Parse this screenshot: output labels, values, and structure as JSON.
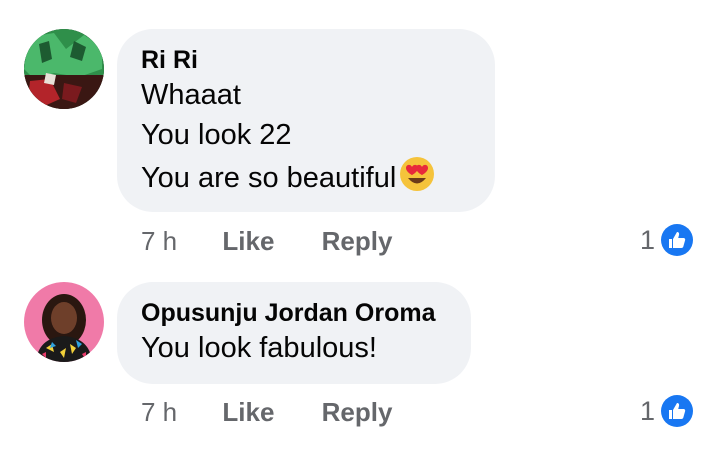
{
  "comments": [
    {
      "author": "Ri Ri",
      "lines": [
        "Whaaat",
        "You look 22",
        "You are so beautiful"
      ],
      "emoji": "heart-eyes-emoji",
      "time": "7 h",
      "like_label": "Like",
      "reply_label": "Reply",
      "reaction_count": "1"
    },
    {
      "author": "Opusunju Jordan Oroma",
      "lines": [
        "You look fabulous!"
      ],
      "time": "7 h",
      "like_label": "Like",
      "reply_label": "Reply",
      "reaction_count": "1"
    }
  ],
  "colors": {
    "bubble": "#f0f2f5",
    "meta_text": "#65676b",
    "like_blue": "#1877f2"
  }
}
